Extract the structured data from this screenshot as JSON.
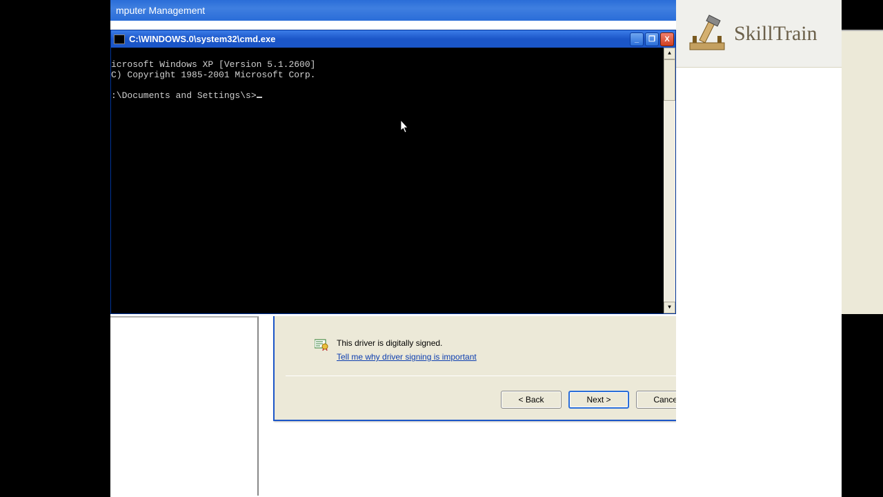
{
  "mgmt": {
    "title": "mputer Management"
  },
  "cmd": {
    "title": "C:\\WINDOWS.0\\system32\\cmd.exe",
    "line1": "icrosoft Windows XP [Version 5.1.2600]",
    "line2": "C) Copyright 1985-2001 Microsoft Corp.",
    "prompt": ":\\Documents and Settings\\s>",
    "minimize": "_",
    "maximize": "❐",
    "close": "X",
    "scroll_up": "▲",
    "scroll_down": "▼"
  },
  "wizard": {
    "signed_text": "This driver is digitally signed.",
    "link": "Tell me why driver signing is important",
    "back": "< Back",
    "next": "Next >",
    "cancel": "Cancel"
  },
  "logo": {
    "text": "SkillTrain"
  }
}
